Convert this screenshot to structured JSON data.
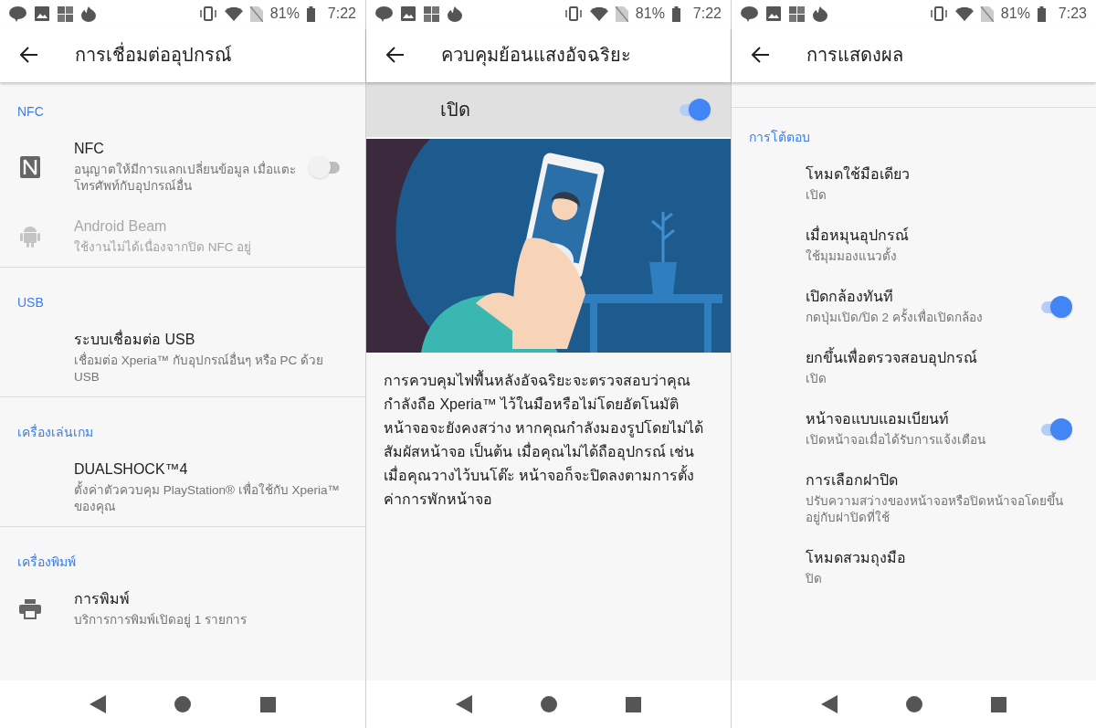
{
  "screens": [
    {
      "kind": "list",
      "status_bar": {
        "battery": "81%",
        "time": "7:22"
      },
      "title": "การเชื่อมต่ออุปกรณ์",
      "sections": [
        {
          "header": "NFC",
          "items": [
            {
              "kind": "nfc",
              "title": "NFC",
              "subtitle": "อนุญาตให้มีการแลกเปลี่ยนข้อมูล เมื่อแตะโทรศัพท์กับอุปกรณ์อื่น",
              "disabled": false,
              "toggle": {
                "on": false
              }
            },
            {
              "kind": "android",
              "title": "Android Beam",
              "subtitle": "ใช้งานไม่ได้เนื่องจากปิด NFC อยู่",
              "disabled": true
            }
          ]
        },
        {
          "header": "USB",
          "items": [
            {
              "title": "ระบบเชื่อมต่อ USB",
              "subtitle": "เชื่อมต่อ Xperia™ กับอุปกรณ์อื่นๆ หรือ PC ด้วย USB",
              "disabled": false
            }
          ]
        },
        {
          "header": "เครื่องเล่นเกม",
          "items": [
            {
              "title": "DUALSHOCK™4",
              "subtitle": "ตั้งค่าตัวควบคุม PlayStation® เพื่อใช้กับ Xperia™ ของคุณ",
              "disabled": false
            }
          ]
        },
        {
          "header": "เครื่องพิมพ์",
          "items": [
            {
              "kind": "printer",
              "title": "การพิมพ์",
              "subtitle": "บริการการพิมพ์เปิดอยู่ 1 รายการ",
              "disabled": false
            }
          ]
        }
      ]
    },
    {
      "kind": "feature",
      "status_bar": {
        "battery": "81%",
        "time": "7:22"
      },
      "title": "ควบคุมย้อนแสงอัจฉริยะ",
      "master": {
        "label": "เปิด",
        "on": true
      },
      "description": "การควบคุมไฟพื้นหลังอัจฉริยะจะตรวจสอบว่าคุณกำลังถือ Xperia™ ไว้ในมือหรือไม่โดยอัตโนมัติ หน้าจอจะยังคงสว่าง หากคุณกำลังมองรูปโดยไม่ได้สัมผัสหน้าจอ เป็นต้น เมื่อคุณไม่ได้ถืออุปกรณ์ เช่น เมื่อคุณวางไว้บนโต๊ะ หน้าจอก็จะปิดลงตามการตั้งค่าการพักหน้าจอ"
    },
    {
      "kind": "list",
      "status_bar": {
        "battery": "81%",
        "time": "7:23"
      },
      "title": "การแสดงผล",
      "top_divider": true,
      "sections": [
        {
          "header": "การโต้ตอบ",
          "items": [
            {
              "title": "โหมดใช้มือเดียว",
              "subtitle": "เปิด",
              "disabled": false
            },
            {
              "title": "เมื่อหมุนอุปกรณ์",
              "subtitle": "ใช้มุมมองแนวตั้ง",
              "disabled": false
            },
            {
              "title": "เปิดกล้องทันที",
              "subtitle": "กดปุ่มเปิด/ปิด 2 ครั้งเพื่อเปิดกล้อง",
              "disabled": false,
              "toggle": {
                "on": true
              }
            },
            {
              "title": "ยกขึ้นเพื่อตรวจสอบอุปกรณ์",
              "subtitle": "เปิด",
              "disabled": false
            },
            {
              "title": "หน้าจอแบบแอมเบียนท์",
              "subtitle": "เปิดหน้าจอเมื่อได้รับการแจ้งเตือน",
              "disabled": false,
              "toggle": {
                "on": true
              }
            },
            {
              "title": "การเลือกฝาปิด",
              "subtitle": "ปรับความสว่างของหน้าจอหรือปิดหน้าจอโดยขึ้นอยู่กับฝาปิดที่ใช้",
              "disabled": false
            },
            {
              "title": "โหมดสวมถุงมือ",
              "subtitle": "ปิด",
              "disabled": false
            }
          ]
        }
      ]
    }
  ]
}
